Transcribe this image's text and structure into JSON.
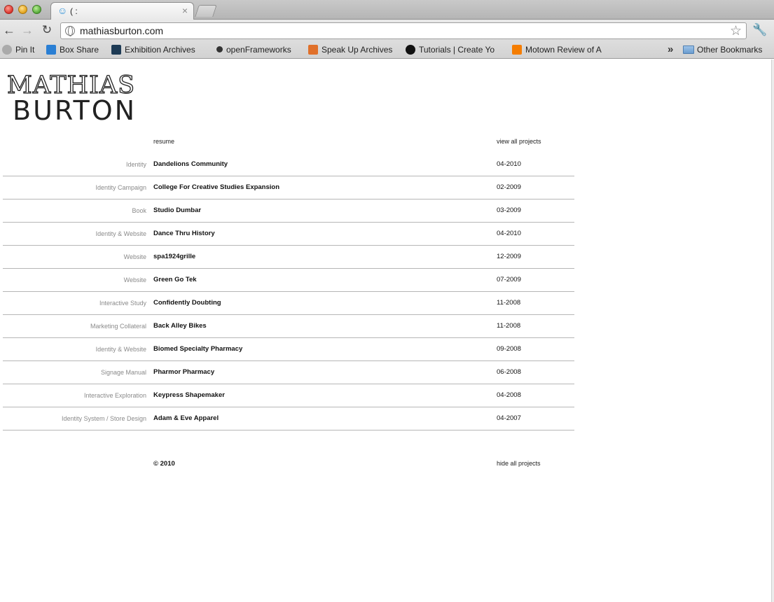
{
  "browser": {
    "tab_title": "( :",
    "tab_close": "×",
    "url": "mathiasburton.com",
    "bookmarks": [
      {
        "label": "Pin It",
        "icon": "pin-it-icon",
        "color": "#aaaaaa"
      },
      {
        "label": "Box Share",
        "icon": "box-icon",
        "color": "#2a7fd4"
      },
      {
        "label": "Exhibition Archives",
        "icon": "exhibition-icon",
        "color": "#1e3b55"
      },
      {
        "label": "openFrameworks",
        "icon": "openframeworks-icon",
        "color": "#333333"
      },
      {
        "label": "Speak Up Archives",
        "icon": "speakup-icon",
        "color": "#e0702a"
      },
      {
        "label": "Tutorials | Create Yo",
        "icon": "tutorials-icon",
        "color": "#111111"
      },
      {
        "label": "Motown Review of A",
        "icon": "blogger-icon",
        "color": "#f57d00"
      }
    ],
    "more_bookmarks": "»",
    "other_bookmarks": "Other Bookmarks"
  },
  "site": {
    "logo_top": "MATHIAS",
    "logo_bottom": "BURTON",
    "resume_link": "resume",
    "view_all_link": "view all projects",
    "hide_all_link": "hide all projects",
    "copyright": "© 2010"
  },
  "projects": [
    {
      "category": "Identity",
      "title": "Dandelions Community",
      "date": "04-2010"
    },
    {
      "category": "Identity Campaign",
      "title": "College For Creative Studies Expansion",
      "date": "02-2009"
    },
    {
      "category": "Book",
      "title": "Studio Dumbar",
      "date": "03-2009"
    },
    {
      "category": "Identity & Website",
      "title": "Dance Thru History",
      "date": "04-2010"
    },
    {
      "category": "Website",
      "title": "spa1924grille",
      "date": "12-2009"
    },
    {
      "category": "Website",
      "title": "Green Go Tek",
      "date": "07-2009"
    },
    {
      "category": "Interactive Study",
      "title": "Confidently Doubting",
      "date": "11-2008"
    },
    {
      "category": "Marketing Collateral",
      "title": "Back Alley Bikes",
      "date": "11-2008"
    },
    {
      "category": "Identity & Website",
      "title": "Biomed Specialty Pharmacy",
      "date": "09-2008"
    },
    {
      "category": "Signage Manual",
      "title": "Pharmor Pharmacy",
      "date": "06-2008"
    },
    {
      "category": "Interactive Exploration",
      "title": "Keypress Shapemaker",
      "date": "04-2008"
    },
    {
      "category": "Identity System / Store Design",
      "title": "Adam & Eve Apparel",
      "date": "04-2007"
    }
  ]
}
